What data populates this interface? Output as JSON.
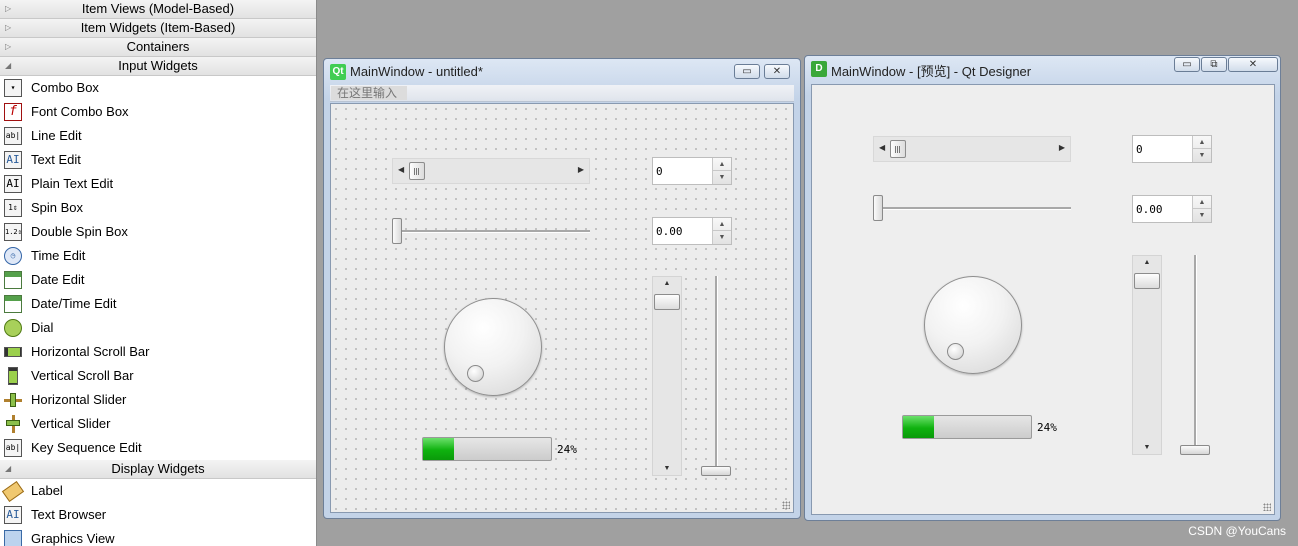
{
  "widget_box": {
    "categories": {
      "item_views": "Item Views (Model-Based)",
      "item_widgets": "Item Widgets (Item-Based)",
      "containers": "Containers",
      "input_widgets": "Input Widgets",
      "display_widgets": "Display Widgets"
    },
    "input_items": [
      {
        "label": "Combo Box",
        "icon": "combo-box-icon"
      },
      {
        "label": "Font Combo Box",
        "icon": "font-combo-box-icon"
      },
      {
        "label": "Line Edit",
        "icon": "line-edit-icon"
      },
      {
        "label": "Text Edit",
        "icon": "text-edit-icon"
      },
      {
        "label": "Plain Text Edit",
        "icon": "plain-text-edit-icon"
      },
      {
        "label": "Spin Box",
        "icon": "spin-box-icon"
      },
      {
        "label": "Double Spin Box",
        "icon": "double-spin-box-icon"
      },
      {
        "label": "Time Edit",
        "icon": "clock-icon"
      },
      {
        "label": "Date Edit",
        "icon": "calendar-icon"
      },
      {
        "label": "Date/Time Edit",
        "icon": "calendar-clock-icon"
      },
      {
        "label": "Dial",
        "icon": "dial-icon"
      },
      {
        "label": "Horizontal Scroll Bar",
        "icon": "horizontal-scroll-bar-icon"
      },
      {
        "label": "Vertical Scroll Bar",
        "icon": "vertical-scroll-bar-icon"
      },
      {
        "label": "Horizontal Slider",
        "icon": "horizontal-slider-icon"
      },
      {
        "label": "Vertical Slider",
        "icon": "vertical-slider-icon"
      },
      {
        "label": "Key Sequence Edit",
        "icon": "key-sequence-edit-icon"
      }
    ],
    "display_items": [
      {
        "label": "Label",
        "icon": "label-tag-icon"
      },
      {
        "label": "Text Browser",
        "icon": "text-browser-icon"
      },
      {
        "label": "Graphics View",
        "icon": "graphics-view-icon"
      }
    ]
  },
  "editor_window": {
    "title": "MainWindow - untitled*",
    "app_icon_text": "Qt",
    "menu_hint": "在这里输入",
    "spin_value": "0",
    "double_spin_value": "0.00",
    "progress_percent": 24,
    "progress_text": "24%"
  },
  "preview_window": {
    "title": "MainWindow - [预览] - Qt Designer",
    "app_icon_text": "D",
    "spin_value": "0",
    "double_spin_value": "0.00",
    "progress_percent": 24,
    "progress_text": "24%"
  },
  "glyphs": {
    "minimize": "▭",
    "maximize": "⧉",
    "close": "✕",
    "arrow_left": "◀",
    "arrow_right": "▶",
    "arrow_up": "▲",
    "arrow_down": "▼",
    "collapsed": "▷",
    "expanded": "◢"
  },
  "colors": {
    "qt_green": "#41cd52",
    "designer_green": "#3aa83a",
    "progress_green": "#0fb20f"
  },
  "watermark": "CSDN @YouCans"
}
